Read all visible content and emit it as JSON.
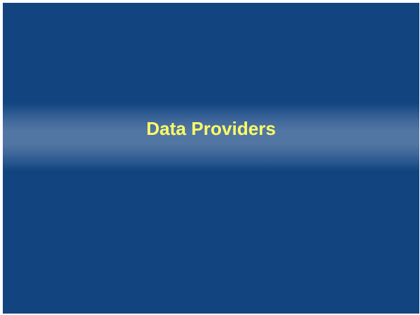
{
  "slide": {
    "title": "Data Providers"
  },
  "colors": {
    "background": "#124580",
    "band_highlight": "#5276a3",
    "title_text": "#ffff66"
  }
}
